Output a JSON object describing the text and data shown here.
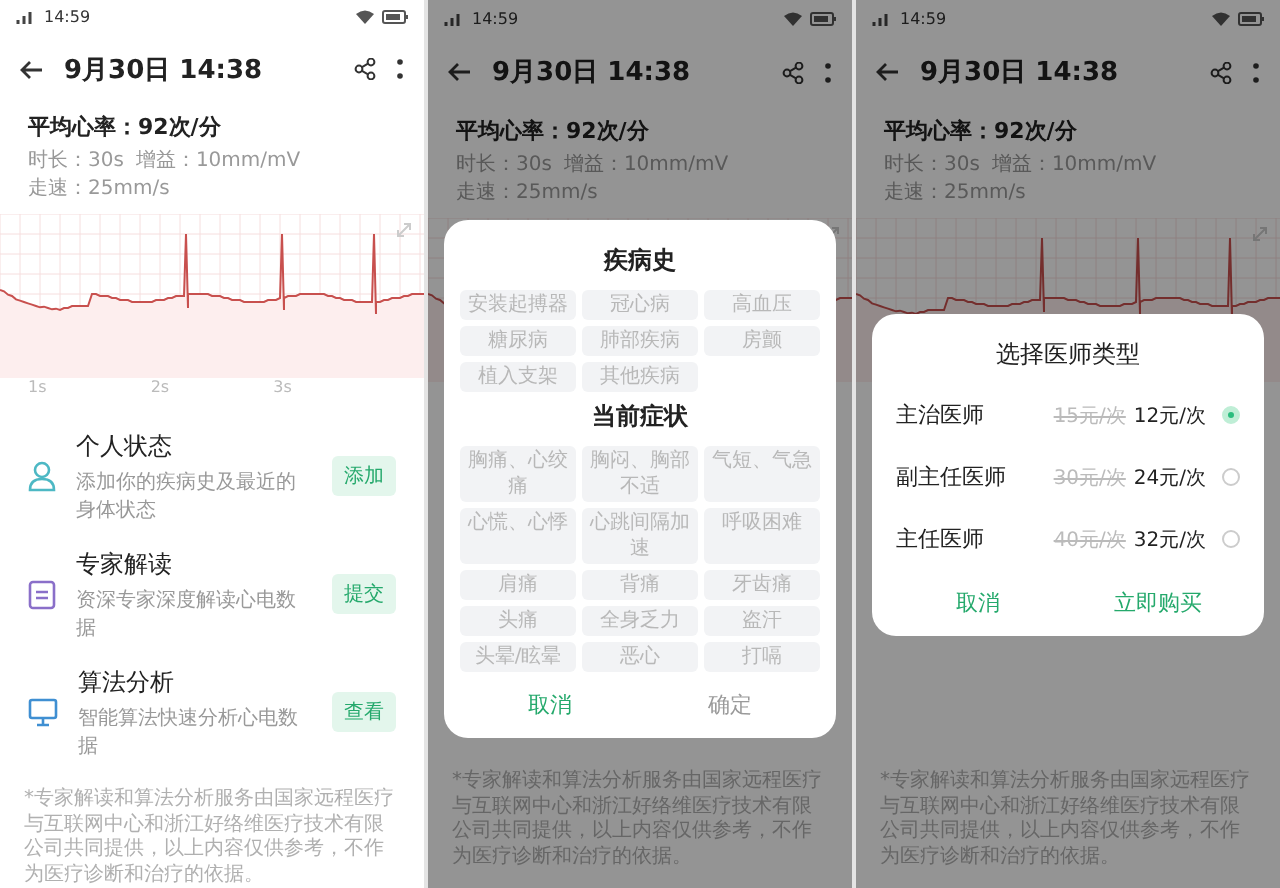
{
  "screens": [
    {
      "status_bar": {
        "time": "14:59"
      },
      "header": {
        "title": "9月30日 14:38"
      },
      "summary": {
        "heart_rate": "平均心率：92次/分",
        "meta": [
          "时长：30s",
          "增益：10mm/mV",
          "走速：25mm/s"
        ]
      },
      "chart": {
        "x_labels": [
          "1s",
          "2s",
          "3s"
        ]
      },
      "services": [
        {
          "kind": "person",
          "title": "个人状态",
          "subtitle": "添加你的疾病史及最近的身体状态",
          "action": "添加"
        },
        {
          "kind": "document",
          "title": "专家解读",
          "subtitle": "资深专家深度解读心电数据",
          "action": "提交"
        },
        {
          "kind": "monitor",
          "title": "算法分析",
          "subtitle": "智能算法快速分析心电数据",
          "action": "查看"
        }
      ],
      "disclaimer": "*专家解读和算法分析服务由国家远程医疗与互联网中心和浙江好络维医疗技术有限公司共同提供，以上内容仅供参考，不作为医疗诊断和治疗的依据。"
    },
    {
      "status_bar": {
        "time": "14:59"
      },
      "header": {
        "title": "9月30日 14:38"
      },
      "summary": {
        "heart_rate": "平均心率：92次/分",
        "meta": [
          "时长：30s",
          "增益：10mm/mV",
          "走速：25mm/s"
        ]
      },
      "disclaimer": "*专家解读和算法分析服务由国家远程医疗与互联网中心和浙江好络维医疗技术有限公司共同提供，以上内容仅供参考，不作为医疗诊断和治疗的依据。",
      "dialog": {
        "kind": "conditions",
        "sections": [
          {
            "title": "疾病史",
            "options": [
              {
                "label": "安装起搏器",
                "selected": false
              },
              {
                "label": "冠心病",
                "selected": false
              },
              {
                "label": "高血压",
                "selected": false
              },
              {
                "label": "糖尿病",
                "selected": false
              },
              {
                "label": "肺部疾病",
                "selected": false
              },
              {
                "label": "房颤",
                "selected": false
              },
              {
                "label": "植入支架",
                "selected": false
              },
              {
                "label": "其他疾病",
                "selected": false
              }
            ]
          },
          {
            "title": "当前症状",
            "options": [
              {
                "label": "胸痛、心绞痛",
                "selected": false
              },
              {
                "label": "胸闷、胸部不适",
                "selected": false
              },
              {
                "label": "气短、气急",
                "selected": false
              },
              {
                "label": "心慌、心悸",
                "selected": false
              },
              {
                "label": "心跳间隔加速",
                "selected": false
              },
              {
                "label": "呼吸困难",
                "selected": false
              },
              {
                "label": "肩痛",
                "selected": false
              },
              {
                "label": "背痛",
                "selected": false
              },
              {
                "label": "牙齿痛",
                "selected": false
              },
              {
                "label": "头痛",
                "selected": false
              },
              {
                "label": "全身乏力",
                "selected": false
              },
              {
                "label": "盗汗",
                "selected": false
              },
              {
                "label": "头晕/眩晕",
                "selected": false
              },
              {
                "label": "恶心",
                "selected": false
              },
              {
                "label": "打嗝",
                "selected": false
              }
            ]
          }
        ],
        "buttons": [
          {
            "label": "取消",
            "disabled": false
          },
          {
            "label": "确定",
            "disabled": true
          }
        ]
      }
    },
    {
      "status_bar": {
        "time": "14:59"
      },
      "header": {
        "title": "9月30日 14:38"
      },
      "summary": {
        "heart_rate": "平均心率：92次/分",
        "meta": [
          "时长：30s",
          "增益：10mm/mV",
          "走速：25mm/s"
        ]
      },
      "disclaimer": "*专家解读和算法分析服务由国家远程医疗与互联网中心和浙江好络维医疗技术有限公司共同提供，以上内容仅供参考，不作为医疗诊断和治疗的依据。",
      "dialog": {
        "kind": "doctor",
        "title": "选择医师类型",
        "options": [
          {
            "name": "主治医师",
            "old_price": "15元/次",
            "price": "12元/次",
            "selected": true
          },
          {
            "name": "副主任医师",
            "old_price": "30元/次",
            "price": "24元/次",
            "selected": false
          },
          {
            "name": "主任医师",
            "old_price": "40元/次",
            "price": "32元/次",
            "selected": false
          }
        ],
        "buttons": [
          {
            "label": "取消",
            "disabled": false
          },
          {
            "label": "立即购买",
            "disabled": false
          }
        ]
      }
    }
  ]
}
